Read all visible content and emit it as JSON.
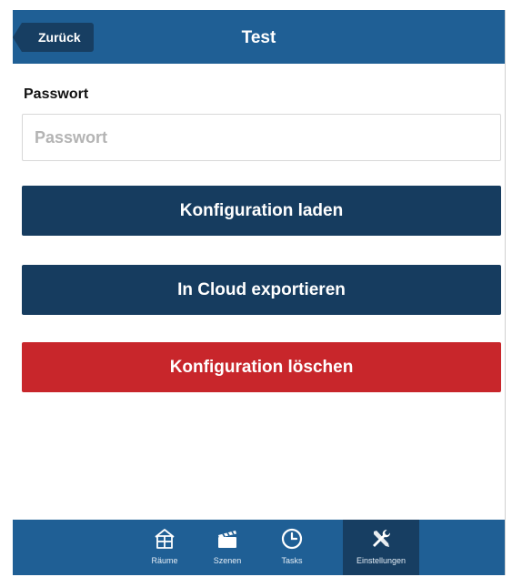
{
  "header": {
    "back_label": "Zurück",
    "title": "Test"
  },
  "password": {
    "label": "Passwort",
    "placeholder": "Passwort",
    "value": ""
  },
  "actions": {
    "load_label": "Konfiguration laden",
    "cloud_label": "In Cloud exportieren",
    "delete_label": "Konfiguration löschen"
  },
  "tabs": [
    {
      "label": "Räume",
      "icon": "house-icon",
      "active": false
    },
    {
      "label": "Szenen",
      "icon": "clapperboard-icon",
      "active": false
    },
    {
      "label": "Tasks",
      "icon": "clock-icon",
      "active": false
    },
    {
      "label": "Einstellungen",
      "icon": "wrench-screwdriver-icon",
      "active": true
    }
  ],
  "colors": {
    "header": "#1f5f95",
    "dark_button": "#163c5f",
    "danger_button": "#c8262b"
  }
}
